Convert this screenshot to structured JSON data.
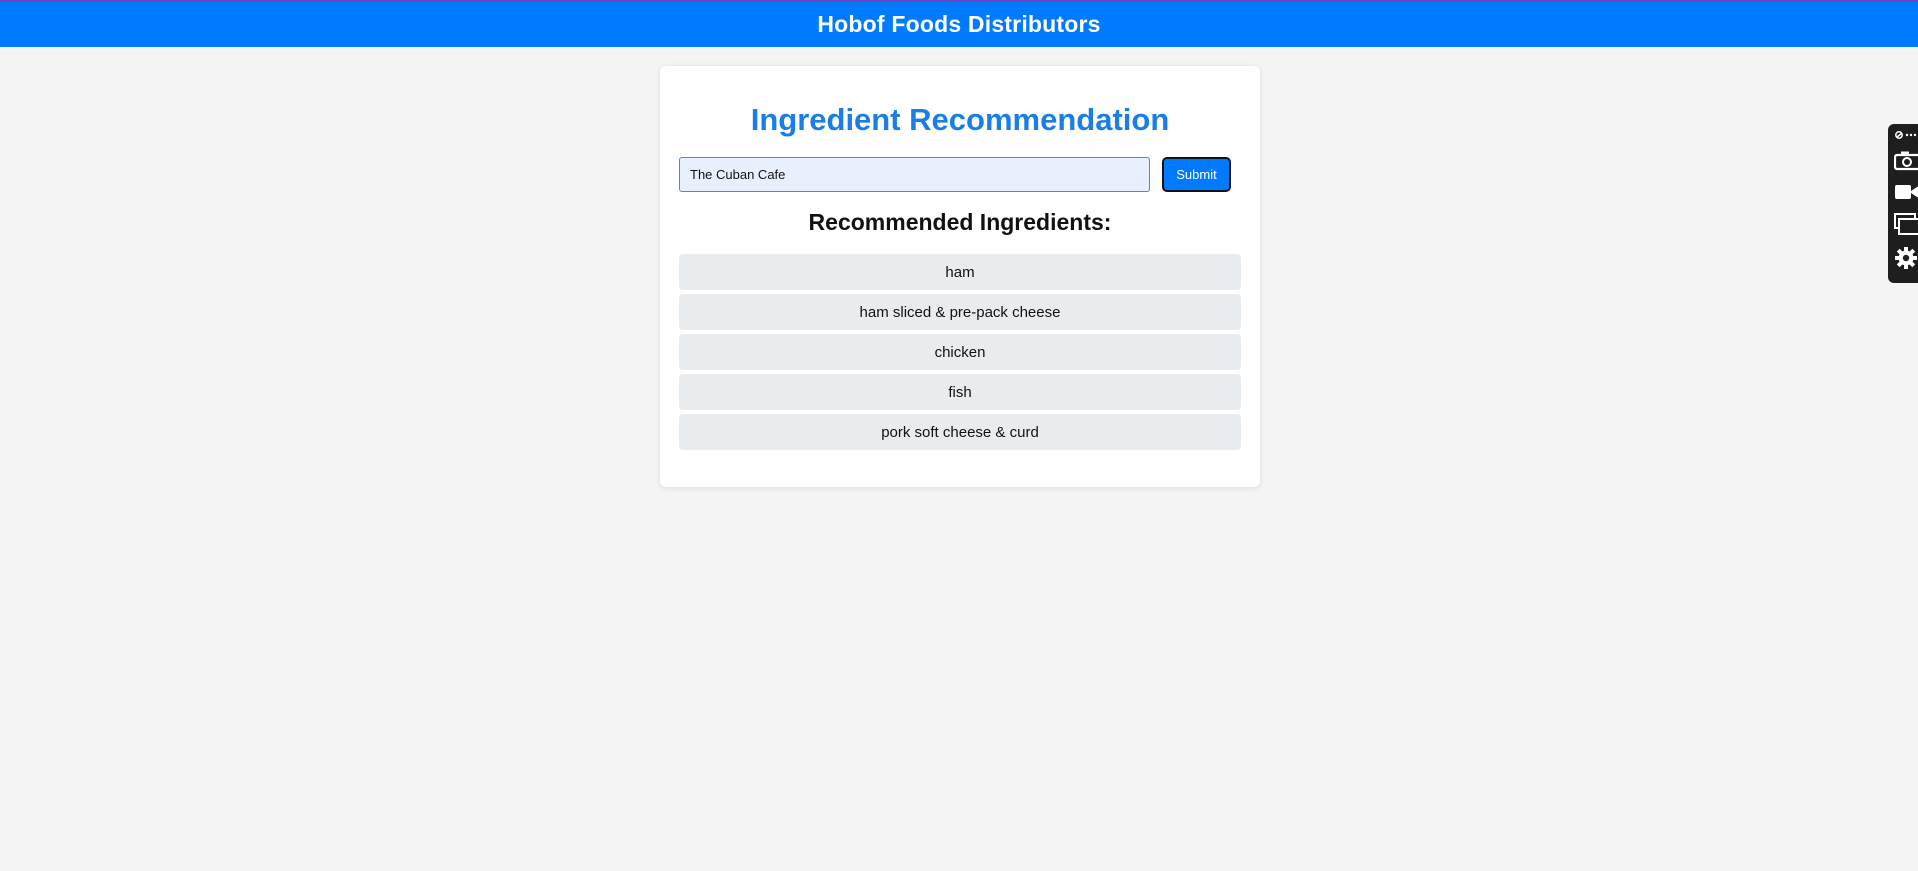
{
  "header": {
    "title": "Hobof Foods Distributors"
  },
  "main": {
    "title": "Ingredient Recommendation",
    "search": {
      "value": "The Cuban Cafe",
      "placeholder": ""
    },
    "submit_label": "Submit",
    "results_heading": "Recommended Ingredients:",
    "ingredients": [
      "ham",
      "ham sliced & pre-pack cheese",
      "chicken",
      "fish",
      "pork soft cheese & curd"
    ]
  },
  "side_toolbar": {
    "icons": [
      "link-icon",
      "more-icon",
      "camera-icon",
      "video-icon",
      "windows-icon",
      "gear-icon"
    ]
  },
  "colors": {
    "header_bg": "#007bff",
    "title_blue": "#1a7ee8",
    "page_bg": "#f4f4f4",
    "item_bg": "#e9ecef"
  }
}
